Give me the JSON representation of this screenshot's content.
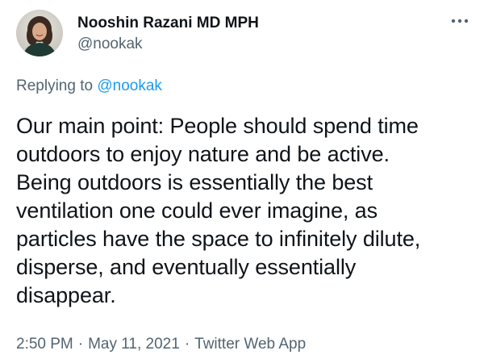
{
  "author": {
    "display_name": "Nooshin Razani MD MPH",
    "handle": "@nookak"
  },
  "reply": {
    "prefix": "Replying to ",
    "handle": "@nookak"
  },
  "tweet": {
    "lines": [
      "Our main point: People should spend time",
      "outdoors to enjoy nature and be active.",
      "Being outdoors is essentially the best",
      "ventilation one could ever imagine, as",
      "particles have the space to infinitely dilute,",
      "disperse, and eventually essentially",
      "disappear."
    ]
  },
  "meta": {
    "time": "2:50 PM",
    "date": "May 11, 2021",
    "source": "Twitter Web App",
    "separator": "·"
  },
  "icons": {
    "more": "more-horizontal-icon",
    "avatar": "profile-photo"
  },
  "colors": {
    "text": "#0f1419",
    "secondary": "#536471",
    "link": "#1d9bf0"
  }
}
